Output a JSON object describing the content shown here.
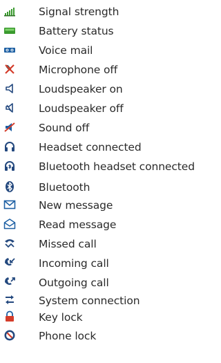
{
  "colors": {
    "signal": "#3a9a2e",
    "battery": "#3a9a2e",
    "icon_blue": "#1d5fa3",
    "icon_dark": "#23487e",
    "text": "#2a2a2a"
  },
  "items": [
    {
      "icon": "signal-strength-icon",
      "label": "Signal strength"
    },
    {
      "icon": "battery-status-icon",
      "label": "Battery status"
    },
    {
      "icon": "voice-mail-icon",
      "label": "Voice mail"
    },
    {
      "icon": "microphone-off-icon",
      "label": "Microphone off"
    },
    {
      "icon": "loudspeaker-on-icon",
      "label": "Loudspeaker on"
    },
    {
      "icon": "loudspeaker-off-icon",
      "label": "Loudspeaker off"
    },
    {
      "icon": "sound-off-icon",
      "label": "Sound off"
    },
    {
      "icon": "headset-icon",
      "label": "Headset connected"
    },
    {
      "icon": "bluetooth-headset-icon",
      "label": "Bluetooth headset connected"
    },
    {
      "icon": "bluetooth-icon",
      "label": "Bluetooth"
    },
    {
      "icon": "new-message-icon",
      "label": "New message"
    },
    {
      "icon": "read-message-icon",
      "label": "Read message"
    },
    {
      "icon": "missed-call-icon",
      "label": "Missed call"
    },
    {
      "icon": "incoming-call-icon",
      "label": "Incoming call"
    },
    {
      "icon": "outgoing-call-icon",
      "label": "Outgoing call"
    },
    {
      "icon": "system-connection-icon",
      "label": "System connection"
    },
    {
      "icon": "key-lock-icon",
      "label": "Key lock"
    },
    {
      "icon": "phone-lock-icon",
      "label": "Phone lock"
    }
  ]
}
